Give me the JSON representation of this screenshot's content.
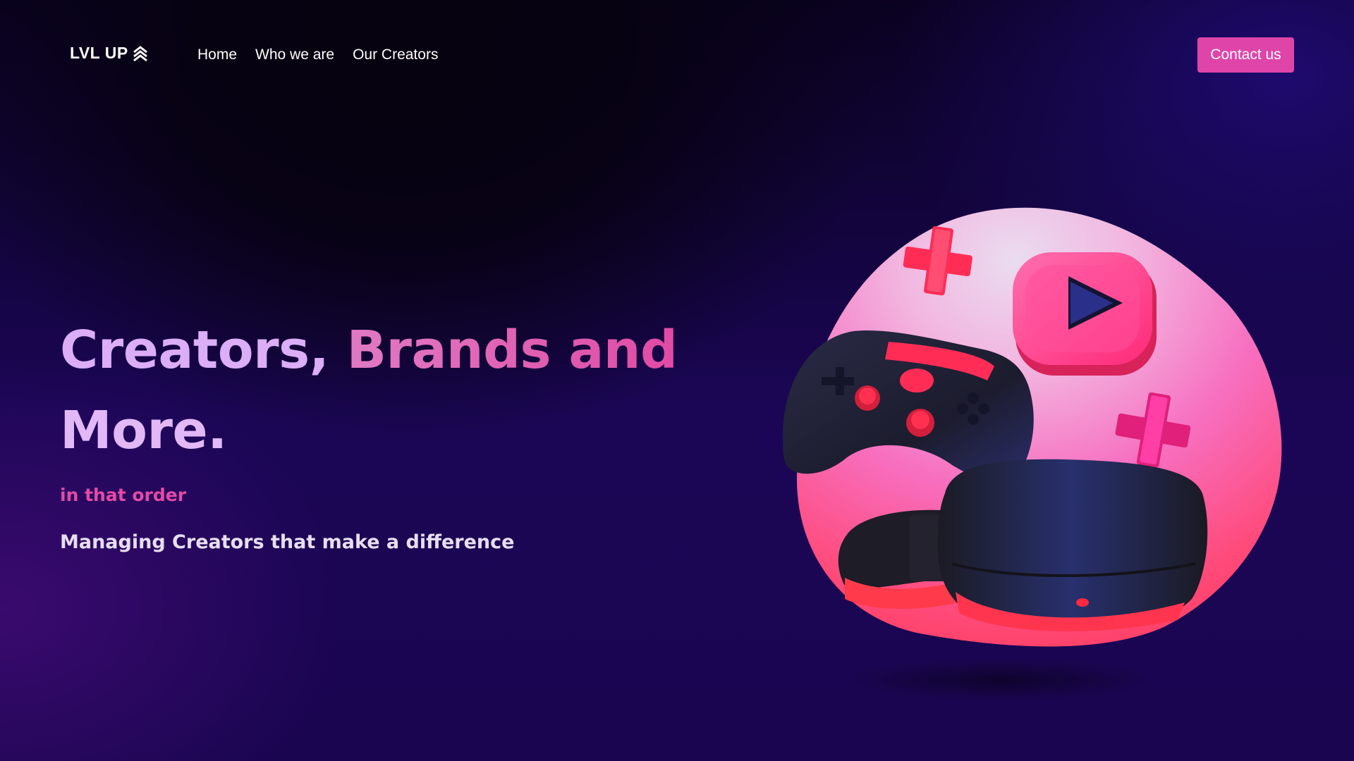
{
  "brand": {
    "logo_text": "LVL UP",
    "logo_icon": "chevrons-up-icon"
  },
  "nav": {
    "items": [
      {
        "label": "Home"
      },
      {
        "label": "Who we are"
      },
      {
        "label": "Our Creators"
      }
    ],
    "contact_label": "Contact us"
  },
  "hero": {
    "headline_part1": "Creators, ",
    "headline_part2": "Brands and",
    "headline_line2": "More.",
    "tagline": "in that order",
    "subline": "Managing Creators that make a difference",
    "illustration": "gaming-controller-vr-headset-illustration"
  },
  "colors": {
    "accent": "#df45a8",
    "headline_light": "#dcaef7",
    "tagline": "#e24aa6",
    "background_dark": "#0a0220",
    "background_purple": "#1b0656"
  }
}
